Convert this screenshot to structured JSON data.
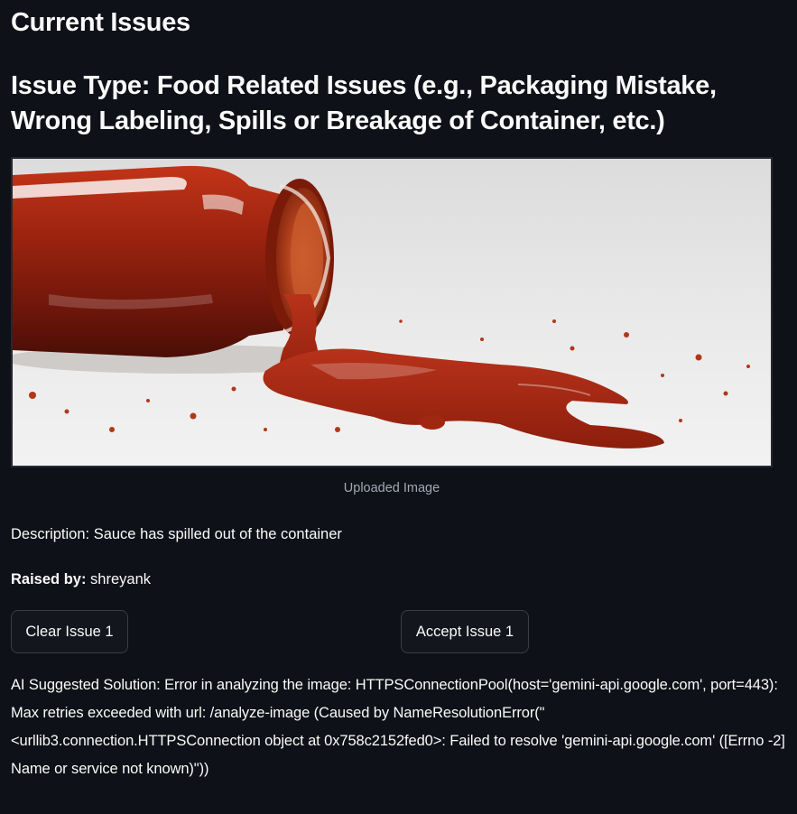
{
  "page": {
    "title": "Current Issues"
  },
  "issue": {
    "type_heading": "Issue Type: Food Related Issues (e.g., Packaging Mistake, Wrong Labeling, Spills or Breakage of Container, etc.)",
    "image_caption": "Uploaded Image",
    "description": "Description: Sauce has spilled out of the container",
    "raised_by_label": "Raised by:",
    "raised_by_value": "shreyank"
  },
  "actions": {
    "clear_label": "Clear Issue 1",
    "accept_label": "Accept Issue 1"
  },
  "ai": {
    "solution_text": "AI Suggested Solution: Error in analyzing the image: HTTPSConnectionPool(host='gemini-api.google.com', port=443): Max retries exceeded with url: /analyze-image (Caused by NameResolutionError(\"<urllib3.connection.HTTPSConnection object at 0x758c2152fed0>: Failed to resolve 'gemini-api.google.com' ([Errno -2] Name or service not known)\"))"
  },
  "colors": {
    "background": "#0e1117",
    "text": "#fafafa",
    "caption": "#a3a8b4",
    "button_bg": "#14161e",
    "button_border": "#3a3d48",
    "sauce": "#a82810"
  }
}
